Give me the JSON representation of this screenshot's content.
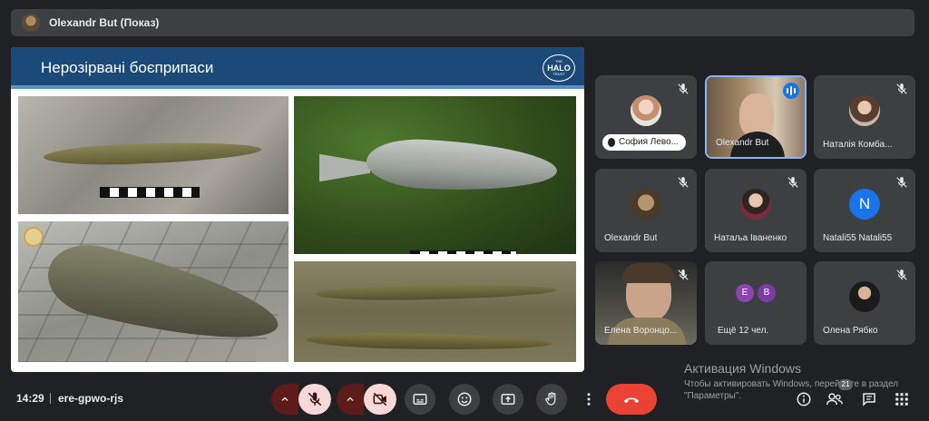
{
  "presenter_bar": {
    "title": "Olexandr But (Показ)"
  },
  "slide": {
    "title": "Нерозірвані боєприпаси",
    "logo": {
      "the": "THE",
      "name": "HALO",
      "trust": "TRUST"
    }
  },
  "participants": [
    {
      "name": "София Лево...",
      "muted": true,
      "speaking_pill": true
    },
    {
      "name": "Olexandr But",
      "active": true,
      "speaking": true
    },
    {
      "name": "Наталія Комба...",
      "muted": true
    },
    {
      "name": "Olexandr But",
      "muted": true
    },
    {
      "name": "Натаља Іваненко",
      "muted": true
    },
    {
      "name": "Natali55 Natali55",
      "muted": true,
      "initial": "N",
      "color": "#1a73e8"
    },
    {
      "name": "Елена Воронцо...",
      "muted": true
    },
    {
      "name": "Ещё 12 чел.",
      "bubbles": [
        "E",
        "B"
      ]
    },
    {
      "name": "Олена Рябко",
      "muted": true
    }
  ],
  "watermark": {
    "line1": "Активация Windows",
    "line2": "Чтобы активировать Windows, перейдите в раздел \"Параметры\"."
  },
  "bottom": {
    "time": "14:29",
    "meeting_code": "ere-gpwo-rjs",
    "participants_count": "21"
  },
  "colors": {
    "accent": "#8ab4f8",
    "end_call": "#ea4335",
    "muted_bg": "#f6d8d6",
    "slide_header": "#1b4a78"
  },
  "icons": [
    "mic-off-icon",
    "camera-off-icon",
    "captions-icon",
    "emoji-icon",
    "present-icon",
    "raise-hand-icon",
    "more-icon",
    "end-call-icon",
    "info-icon",
    "people-icon",
    "chat-icon",
    "activities-icon"
  ]
}
